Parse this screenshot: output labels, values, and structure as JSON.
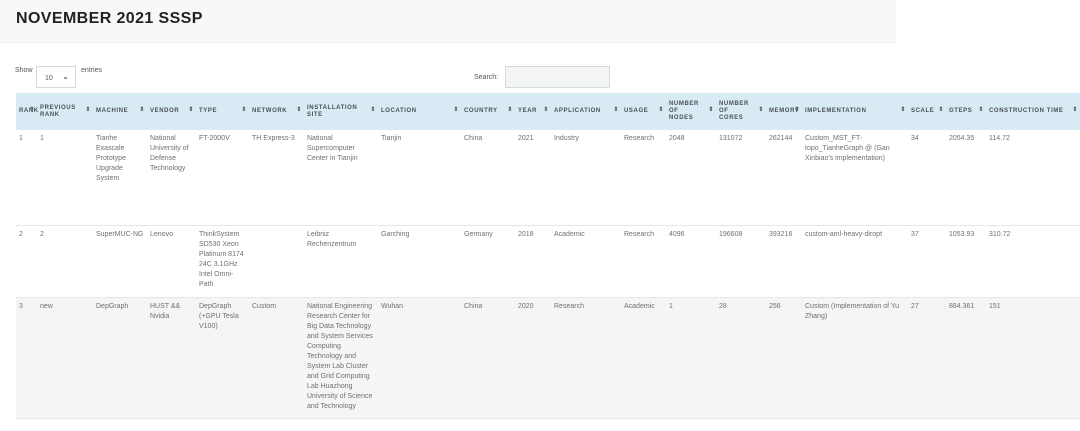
{
  "page": {
    "title": "NOVEMBER 2021 SSSP"
  },
  "controls": {
    "show_label": "Show",
    "page_size": "10",
    "entries_label": "entries",
    "search_label": "Search:",
    "search_value": ""
  },
  "table": {
    "columns": [
      "RANK",
      "PREVIOUS RANK",
      "MACHINE",
      "VENDOR",
      "TYPE",
      "NETWORK",
      "INSTALLATION SITE",
      "LOCATION",
      "COUNTRY",
      "YEAR",
      "APPLICATION",
      "USAGE",
      "NUMBER OF NODES",
      "NUMBER OF CORES",
      "MEMORY",
      "IMPLEMENTATION",
      "SCALE",
      "GTEPS",
      "CONSTRUCTION TIME"
    ],
    "sort_icon": "⇕",
    "rows": [
      [
        "1",
        "1",
        "Tianhe Exascale Prototype Upgrade System",
        "National University of Defense Technology",
        "FT-2000V",
        "TH Express-3",
        "National Supercomputer Center in Tianjin",
        "Tianjin",
        "China",
        "2021",
        "Industry",
        "Research",
        "2048",
        "131072",
        "262144",
        "Custom_MST_FT-topo_TianheGraph @ (Gan Xinbiao's implementation)",
        "34",
        "2054.35",
        "114.72"
      ],
      [
        "2",
        "2",
        "SuperMUC-NG",
        "Lenovo",
        "ThinkSystem SD530 Xeon Platinum 8174 24C 3.1GHz Intel Omni-Path",
        "",
        "Leibniz Rechenzentrum",
        "Garching",
        "Germany",
        "2018",
        "Academic",
        "Research",
        "4096",
        "196608",
        "393216",
        "custom-aml-heavy-diropt",
        "37",
        "1053.93",
        "310.72"
      ],
      [
        "3",
        "new",
        "DepGraph",
        "HUST && Nvidia",
        "DepGraph (+GPU Tesla V100)",
        "Custom",
        "National Engineering Research Center for Big Data Technology and System Services Computing Technology and System Lab Cluster and Grid Computing Lab Huazhong University of Science and Technology",
        "Wuhan",
        "China",
        "2020",
        "Research",
        "Academic",
        "1",
        "28",
        "256",
        "Custom (Implementation of Yu Zhang)",
        "27",
        "884.361",
        "151"
      ]
    ]
  }
}
